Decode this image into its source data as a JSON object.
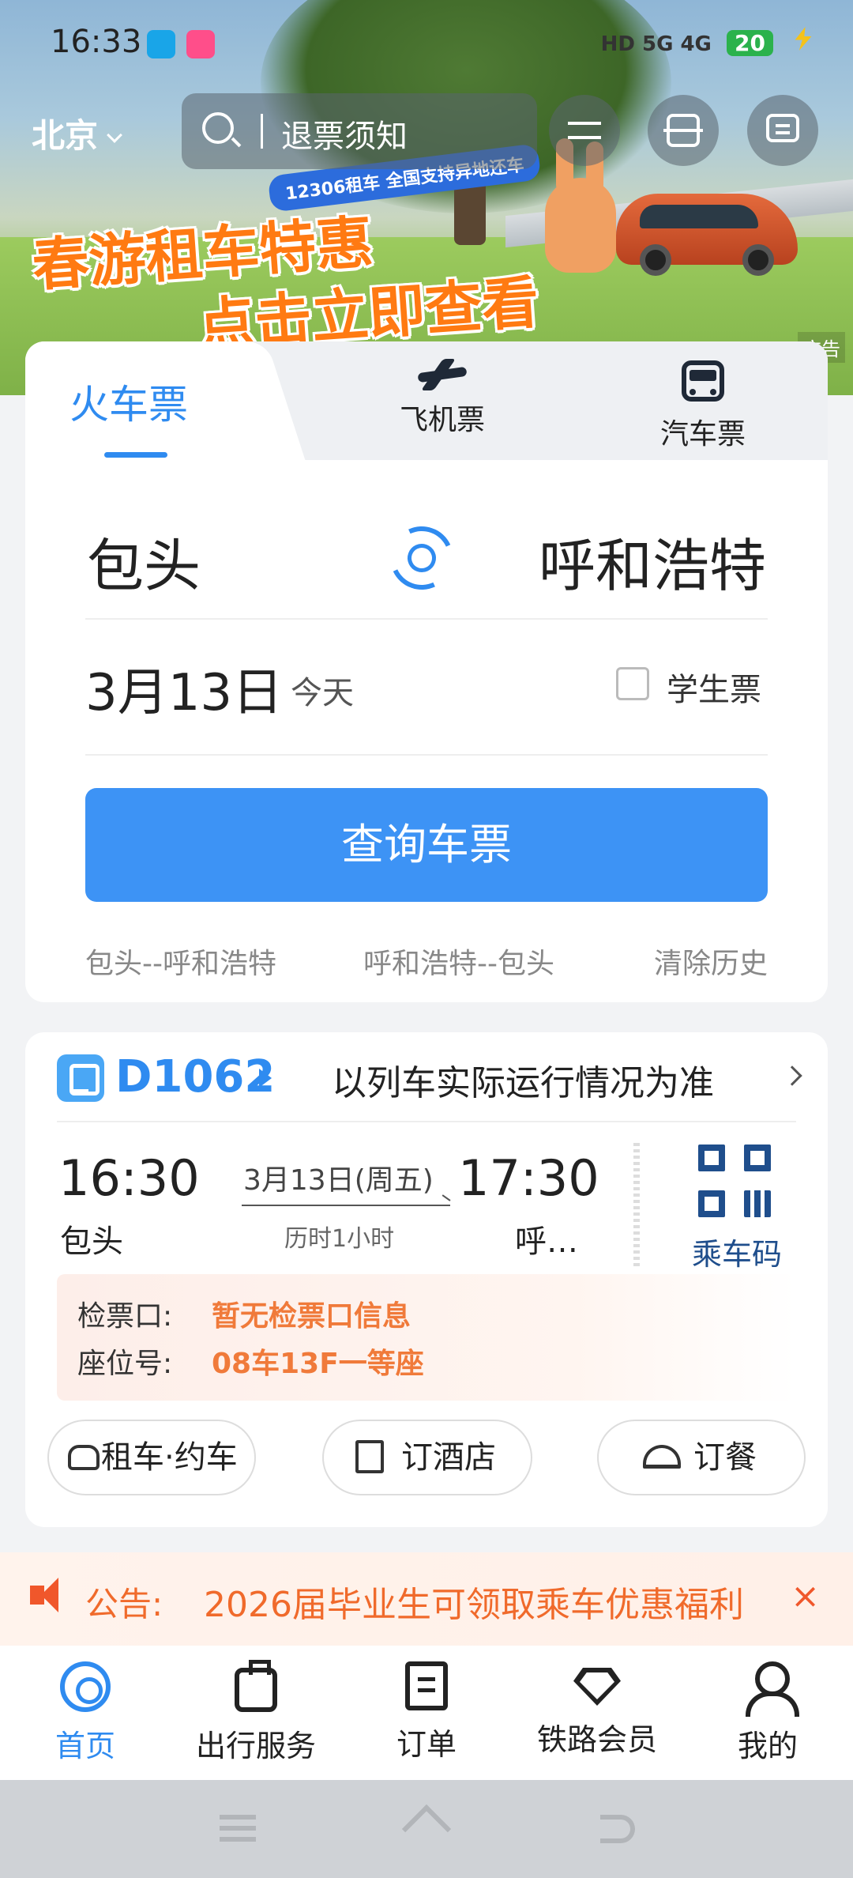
{
  "status_bar": {
    "time": "16:33",
    "signal": "HD 5G 4G",
    "battery": "20"
  },
  "header": {
    "city": "北京",
    "search_placeholder": "退票须知"
  },
  "banner": {
    "pill": "12306租车 全国支持异地还车",
    "line1": "春游租车特惠",
    "line2": "点击立即查看",
    "ad_tag": "广告"
  },
  "tabs": {
    "train": "火车票",
    "plane": "飞机票",
    "bus": "汽车票"
  },
  "search_form": {
    "from": "包头",
    "to": "呼和浩特",
    "date": "3月13日",
    "date_hint": "今天",
    "student_label": "学生票",
    "query_button": "查询车票",
    "history": [
      "包头--呼和浩特",
      "呼和浩特--包头"
    ],
    "clear_history": "清除历史"
  },
  "trip": {
    "train_no": "D1062",
    "notice": "以列车实际运行情况为准",
    "dep_time": "16:30",
    "dep_station": "包头",
    "dep_date": "3月13日(周五)",
    "duration": "历时1小时",
    "arr_time": "17:30",
    "arr_station": "呼…",
    "qr_label": "乘车码",
    "gate_label": "检票口:",
    "gate_value": "暂无检票口信息",
    "seat_label": "座位号:",
    "seat_value": "08车13F一等座",
    "services": [
      "租车·约车",
      "订酒店",
      "订餐"
    ]
  },
  "announcement": {
    "label": "公告:",
    "text": "2026届毕业生可领取乘车优惠福利"
  },
  "bottom_nav": [
    "首页",
    "出行服务",
    "订单",
    "铁路会员",
    "我的"
  ],
  "colors": {
    "accent": "#2f8bf0",
    "warning": "#f06a2b"
  }
}
